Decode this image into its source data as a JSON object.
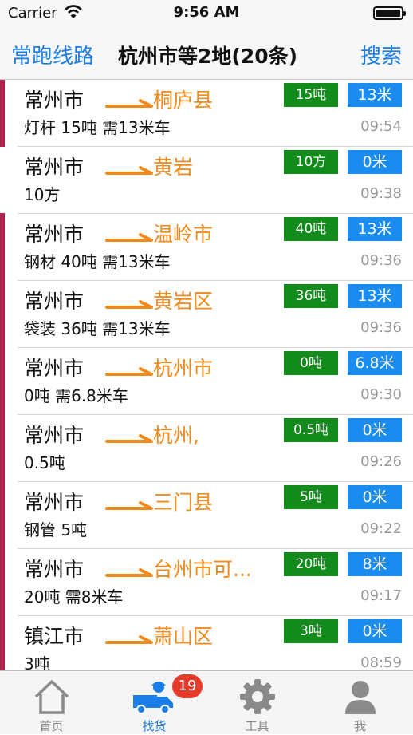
{
  "status_bar": {
    "carrier": "Carrier",
    "time": "9:56 AM"
  },
  "nav": {
    "left_label": "常跑线路",
    "title": "杭州市等2地(20条)",
    "right_label": "搜索"
  },
  "colors": {
    "accent": "#1a7ee6",
    "dest": "#f08a1c",
    "weight_badge": "#138a1c",
    "length_badge": "#1a8cf0",
    "marker": "#b0224e"
  },
  "rows": [
    {
      "origin": "常州市",
      "dest": "桐庐县",
      "detail": "灯杆 15吨 需13米车",
      "weight": "15吨",
      "length": "13米",
      "time": "09:54",
      "marker": true
    },
    {
      "origin": "常州市",
      "dest": "黄岩",
      "detail": " 10方",
      "weight": "10方",
      "length": "0米",
      "time": "09:38",
      "marker": false
    },
    {
      "origin": "常州市",
      "dest": "温岭市",
      "detail": "钢材 40吨 需13米车",
      "weight": "40吨",
      "length": "13米",
      "time": "09:36",
      "marker": true
    },
    {
      "origin": "常州市",
      "dest": "黄岩区",
      "detail": "袋装 36吨 需13米车",
      "weight": "36吨",
      "length": "13米",
      "time": "09:36",
      "marker": true
    },
    {
      "origin": "常州市",
      "dest": "杭州市",
      "detail": " 0吨 需6.8米车",
      "weight": "0吨",
      "length": "6.8米",
      "time": "09:30",
      "marker": true
    },
    {
      "origin": "常州市",
      "dest": "杭州,",
      "detail": " 0.5吨",
      "weight": "0.5吨",
      "length": "0米",
      "time": "09:26",
      "marker": true
    },
    {
      "origin": "常州市",
      "dest": "三门县",
      "detail": "钢管 5吨",
      "weight": "5吨",
      "length": "0米",
      "time": "09:22",
      "marker": true
    },
    {
      "origin": "常州市",
      "dest": "台州市可...",
      "detail": " 20吨 需8米车",
      "weight": "20吨",
      "length": "8米",
      "time": "09:17",
      "marker": true
    },
    {
      "origin": "镇江市",
      "dest": "萧山区",
      "detail": "3吨",
      "weight": "3吨",
      "length": "0米",
      "time": "08:59",
      "marker": true
    }
  ],
  "tabs": [
    {
      "label": "首页",
      "icon": "home-icon"
    },
    {
      "label": "找货",
      "icon": "truck-icon",
      "badge": "19"
    },
    {
      "label": "工具",
      "icon": "gear-icon"
    },
    {
      "label": "我",
      "icon": "person-icon"
    }
  ]
}
